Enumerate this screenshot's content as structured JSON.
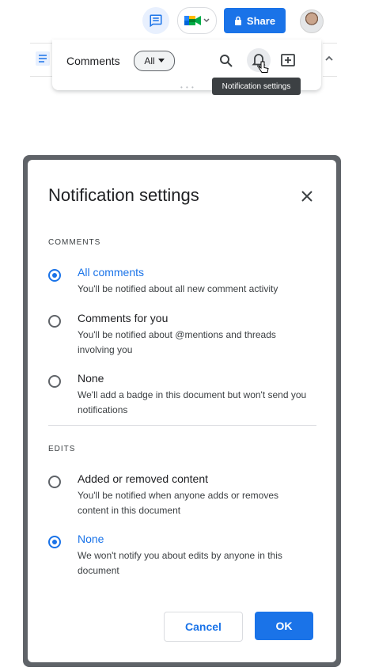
{
  "toolbar": {
    "chat_icon": "comment-history-icon",
    "meet_icon": "google-meet-icon",
    "share_label": "Share",
    "share_icon": "lock-icon",
    "avatar_icon": "user-avatar"
  },
  "comments_panel": {
    "title": "Comments",
    "filter_label": "All",
    "icons": [
      "search-icon",
      "bell-icon",
      "add-comment-icon"
    ]
  },
  "tooltip": "Notification settings",
  "dialog": {
    "title": "Notification settings",
    "comments_section": {
      "label": "COMMENTS",
      "options": [
        {
          "title": "All comments",
          "desc": "You'll be notified about all new comment activity",
          "checked": true
        },
        {
          "title": "Comments for you",
          "desc": "You'll be notified about @mentions and threads involving you",
          "checked": false
        },
        {
          "title": "None",
          "desc": "We'll add a badge in this document but won't send you notifications",
          "checked": false
        }
      ]
    },
    "edits_section": {
      "label": "EDITS",
      "options": [
        {
          "title": "Added or removed content",
          "desc": "You'll be notified when anyone adds or removes content in this document",
          "checked": false
        },
        {
          "title": "None",
          "desc": "We won't notify you about edits by anyone in this document",
          "checked": true
        }
      ]
    },
    "cancel_label": "Cancel",
    "ok_label": "OK"
  },
  "colors": {
    "accent": "#1a73e8",
    "text": "#202124",
    "frame": "#5f6368"
  }
}
